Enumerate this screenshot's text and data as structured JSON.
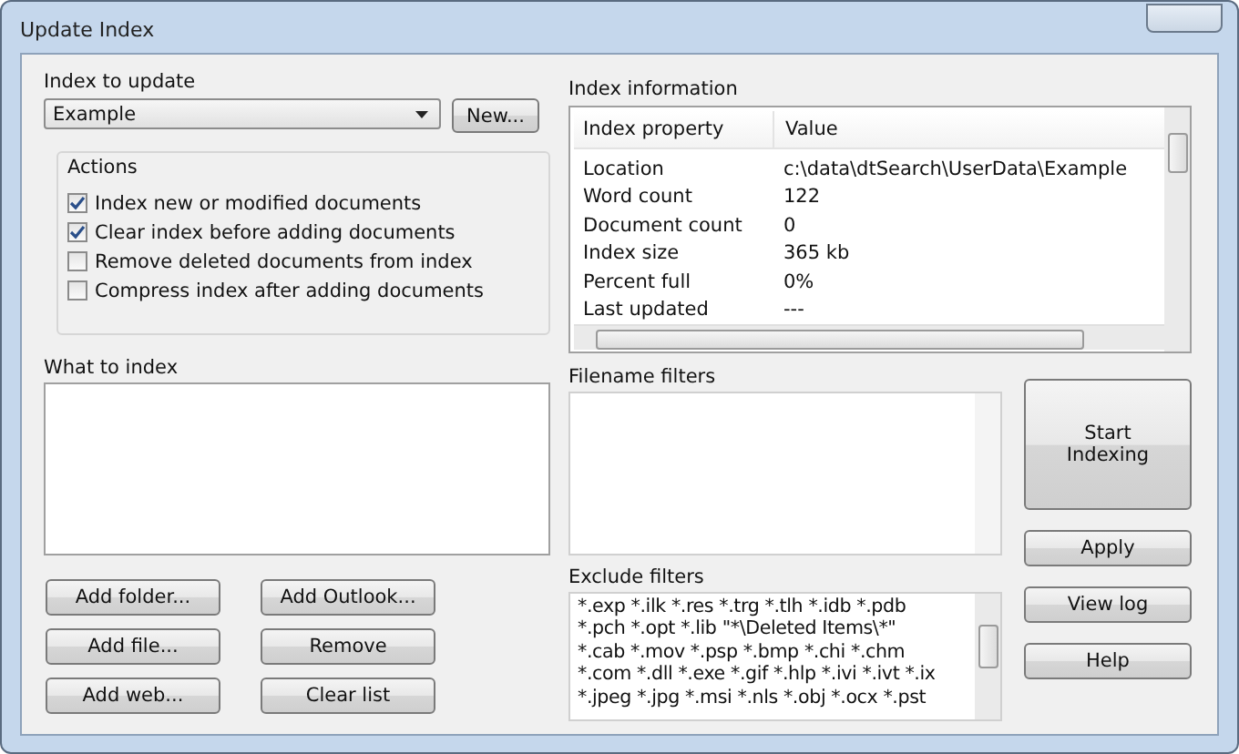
{
  "window": {
    "title": "Update Index"
  },
  "index_to_update": {
    "label": "Index to update",
    "value": "Example",
    "new_button": "New..."
  },
  "actions": {
    "title": "Actions",
    "options": [
      {
        "label": "Index new or modified documents",
        "checked": true
      },
      {
        "label": "Clear index before adding documents",
        "checked": true
      },
      {
        "label": "Remove deleted documents from index",
        "checked": false
      },
      {
        "label": "Compress index after adding documents",
        "checked": false
      }
    ]
  },
  "what_to_index": {
    "label": "What to index"
  },
  "list_buttons": [
    [
      "Add folder...",
      "Add Outlook..."
    ],
    [
      "Add file...",
      "Remove"
    ],
    [
      "Add web...",
      "Clear list"
    ]
  ],
  "index_information": {
    "label": "Index information",
    "columns": [
      "Index property",
      "Value"
    ],
    "rows": [
      [
        "Location",
        "c:\\data\\dtSearch\\UserData\\Example"
      ],
      [
        "Word count",
        "122"
      ],
      [
        "Document count",
        "0"
      ],
      [
        "Index size",
        "365 kb"
      ],
      [
        "Percent full",
        "0%"
      ],
      [
        "Last updated",
        "---"
      ]
    ]
  },
  "filename_filters": {
    "label": "Filename filters"
  },
  "exclude_filters": {
    "label": "Exclude filters",
    "lines": [
      "*.exp *.ilk *.res *.trg *.tlh *.idb *.pdb",
      "*.pch *.opt *.lib \"*\\Deleted Items\\*\"",
      "*.cab *.mov *.psp *.bmp *.chi *.chm",
      "*.com *.dll *.exe *.gif *.hlp *.ivi *.ivt *.ix",
      "*.jpeg *.jpg *.msi *.nls *.obj *.ocx *.pst"
    ]
  },
  "side_buttons": [
    "Start Indexing",
    "Apply",
    "View log",
    "Help"
  ]
}
